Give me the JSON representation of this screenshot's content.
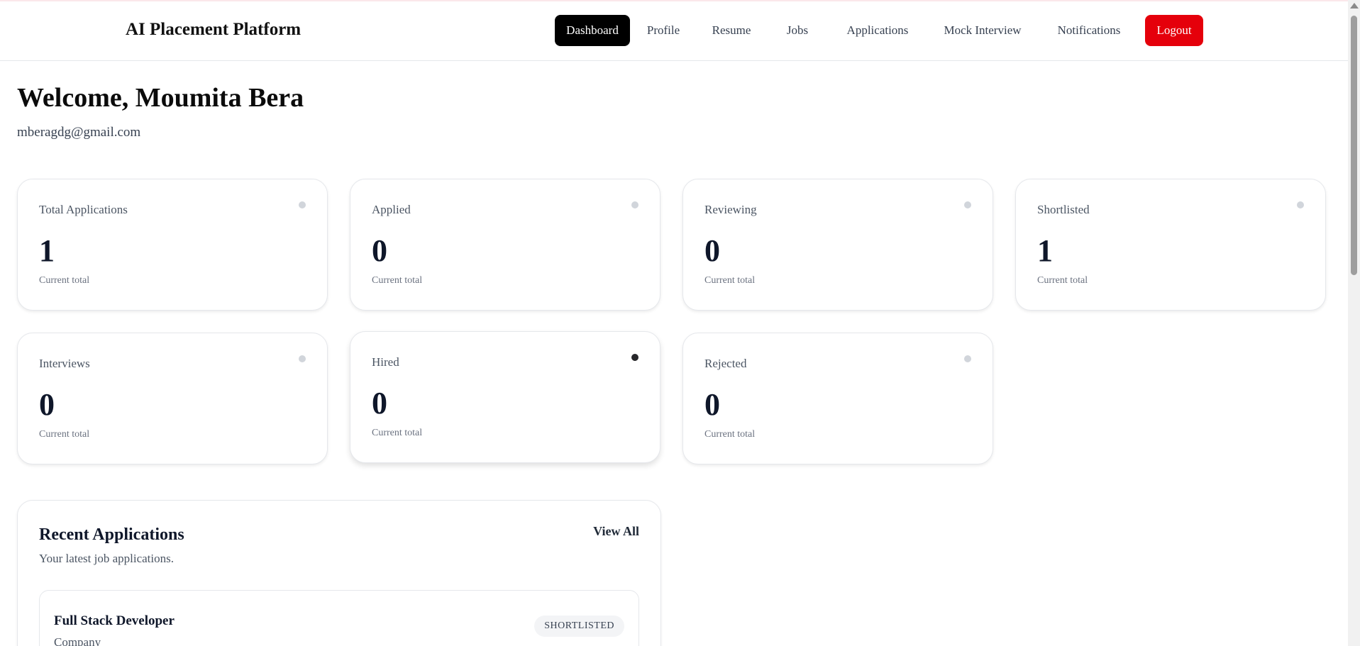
{
  "header": {
    "brand": "AI Placement Platform",
    "nav": [
      {
        "label": "Dashboard",
        "active": true
      },
      {
        "label": "Profile"
      },
      {
        "label": "Resume"
      },
      {
        "label": "Jobs"
      },
      {
        "label": "Applications"
      },
      {
        "label": "Mock Interview"
      },
      {
        "label": "Notifications"
      },
      {
        "label": "Logout"
      }
    ]
  },
  "user": {
    "welcome": "Welcome, Moumita Bera",
    "email": "mberagdg@gmail.com"
  },
  "stats": [
    {
      "label": "Total Applications",
      "value": "1",
      "sub": "Current total"
    },
    {
      "label": "Applied",
      "value": "0",
      "sub": "Current total"
    },
    {
      "label": "Reviewing",
      "value": "0",
      "sub": "Current total"
    },
    {
      "label": "Shortlisted",
      "value": "1",
      "sub": "Current total"
    },
    {
      "label": "Interviews",
      "value": "0",
      "sub": "Current total"
    },
    {
      "label": "Hired",
      "value": "0",
      "sub": "Current total"
    },
    {
      "label": "Rejected",
      "value": "0",
      "sub": "Current total"
    }
  ],
  "recent": {
    "title": "Recent Applications",
    "subtitle": "Your latest job applications.",
    "view_all": "View All",
    "items": [
      {
        "job": "Full Stack Developer",
        "company": "Company",
        "status": "SHORTLISTED"
      }
    ]
  },
  "colors": {
    "active_nav": "#000000",
    "logout": "#e5000b",
    "indicator_dot": "#d1d5db",
    "indicator_dot_dark": "#27272a"
  }
}
